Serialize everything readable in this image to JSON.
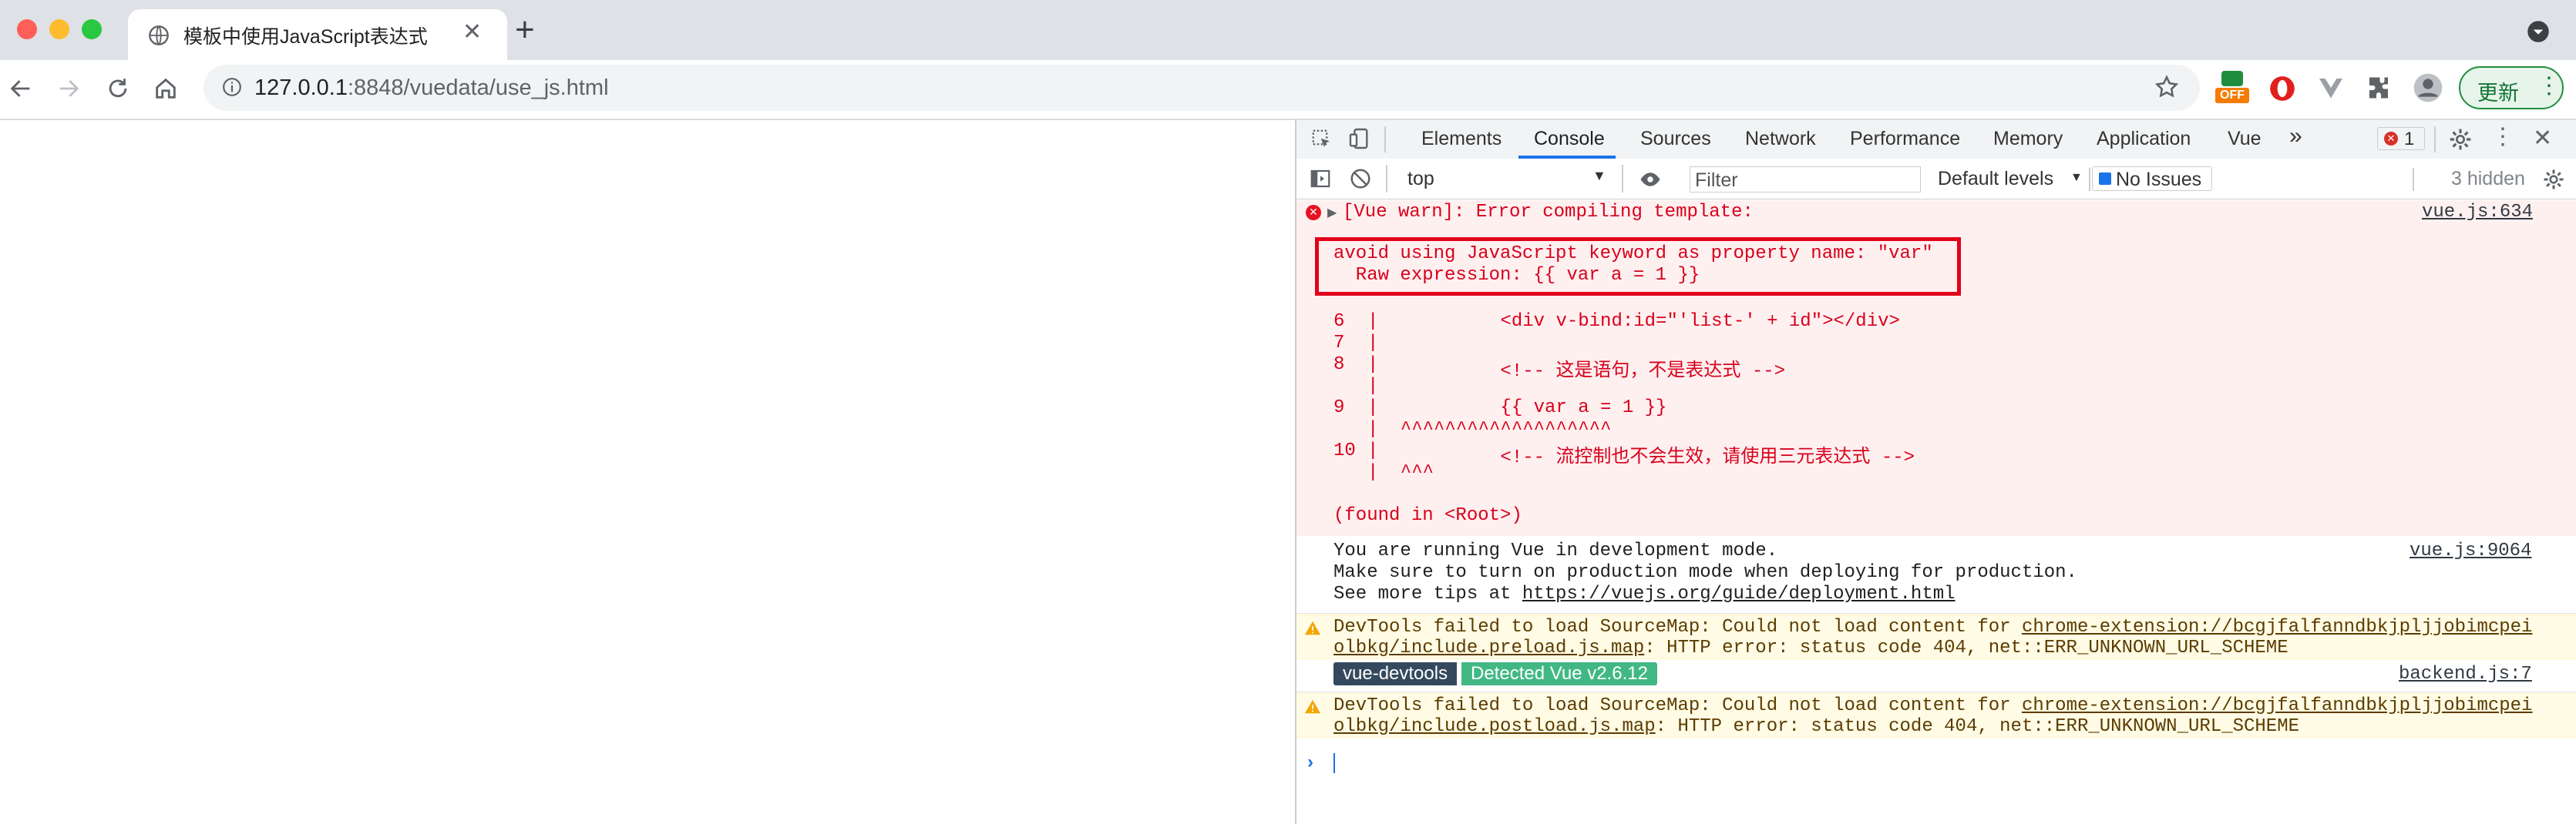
{
  "browser": {
    "tab_title": "模板中使用JavaScript表达式",
    "url_host": "127.0.0.1",
    "url_path": ":8848/vuedata/use_js.html",
    "update_label": "更新",
    "ext_off_label": "OFF",
    "colors": {
      "close": "#ff5f57",
      "minimize": "#febc2e",
      "maximize": "#28c840",
      "update_green": "#1e8e3e"
    }
  },
  "devtools": {
    "tabs": [
      "Elements",
      "Console",
      "Sources",
      "Network",
      "Performance",
      "Memory",
      "Application",
      "Vue"
    ],
    "active_tab": "Console",
    "error_count": "1",
    "context": "top",
    "filter_placeholder": "Filter",
    "levels": "Default levels",
    "issues": "No Issues",
    "hidden": "3 hidden"
  },
  "console": {
    "error": {
      "header": "[Vue warn]: Error compiling template:",
      "source": "vue.js:634",
      "boxed_line1": "avoid using JavaScript keyword as property name: \"var\"",
      "boxed_line2": "  Raw expression: {{ var a = 1 }}",
      "code": [
        {
          "num": "6",
          "text": "           <div v-bind:id=\"'list-' + id\"></div>"
        },
        {
          "num": "7",
          "text": ""
        },
        {
          "num": "8",
          "text": "           <!-- 这是语句，不是表达式 -->"
        },
        {
          "num": "",
          "text": ""
        },
        {
          "num": "9",
          "text": "           {{ var a = 1 }}"
        },
        {
          "num": "",
          "text": "  ^^^^^^^^^^^^^^^^^^^"
        },
        {
          "num": "10",
          "text": "           <!-- 流控制也不会生效，请使用三元表达式 -->"
        },
        {
          "num": "",
          "text": "  ^^^"
        }
      ],
      "found_in": "(found in <Root>)"
    },
    "info": {
      "line1": "You are running Vue in development mode.",
      "line2": "Make sure to turn on production mode when deploying for production.",
      "line3_prefix": "See more tips at ",
      "line3_link": "https://vuejs.org/guide/deployment.html",
      "source": "vue.js:9064"
    },
    "warn1": {
      "prefix": "DevTools failed to load SourceMap: Could not load content for ",
      "link1": "chrome-extension://bcgjfalfanndbkjpljjobimcpei",
      "link2": "olbkg/include.preload.js.map",
      "suffix": ": HTTP error: status code 404, net::ERR_UNKNOWN_URL_SCHEME"
    },
    "vue_badge": {
      "left": "vue-devtools",
      "right": "Detected Vue v2.6.12",
      "source": "backend.js:7",
      "left_color": "#35495e",
      "right_color": "#41b883"
    },
    "warn2": {
      "prefix": "DevTools failed to load SourceMap: Could not load content for ",
      "link1": "chrome-extension://bcgjfalfanndbkjpljjobimcpei",
      "link2": "olbkg/include.postload.js.map",
      "suffix": ": HTTP error: status code 404, net::ERR_UNKNOWN_URL_SCHEME"
    }
  }
}
